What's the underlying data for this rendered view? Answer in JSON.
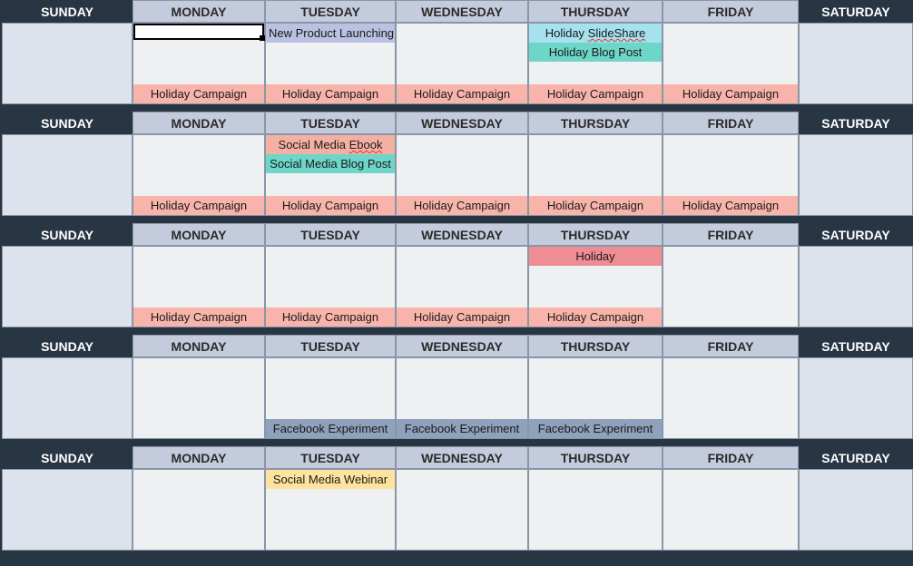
{
  "days": [
    "SUNDAY",
    "MONDAY",
    "TUESDAY",
    "WEDNESDAY",
    "THURSDAY",
    "FRIDAY",
    "SATURDAY"
  ],
  "weeks": [
    {
      "sun": [],
      "mon_bottom": "Holiday Campaign",
      "tue_top": "New Product Launching",
      "tue_bottom": "Holiday Campaign",
      "wed_bottom": "Holiday Campaign",
      "thu_top1": "Holiday SlideShare",
      "thu_top2": "Holiday Blog Post",
      "thu_bottom": "Holiday Campaign",
      "fri_bottom": "Holiday Campaign"
    },
    {
      "mon_bottom": "Holiday Campaign",
      "tue_top1": "Social Media Ebook",
      "tue_top2": "Social Media Blog Post",
      "tue_bottom": "Holiday Campaign",
      "wed_bottom": "Holiday Campaign",
      "thu_bottom": "Holiday Campaign",
      "fri_bottom": "Holiday Campaign"
    },
    {
      "mon_bottom": "Holiday Campaign",
      "tue_bottom": "Holiday Campaign",
      "wed_bottom": "Holiday Campaign",
      "thu_top": "Holiday",
      "thu_bottom": "Holiday Campaign"
    },
    {
      "tue_bottom": "Facebook Experiment",
      "wed_bottom": "Facebook Experiment",
      "thu_bottom": "Facebook Experiment"
    },
    {
      "tue_top": "Social Media Webinar"
    }
  ]
}
